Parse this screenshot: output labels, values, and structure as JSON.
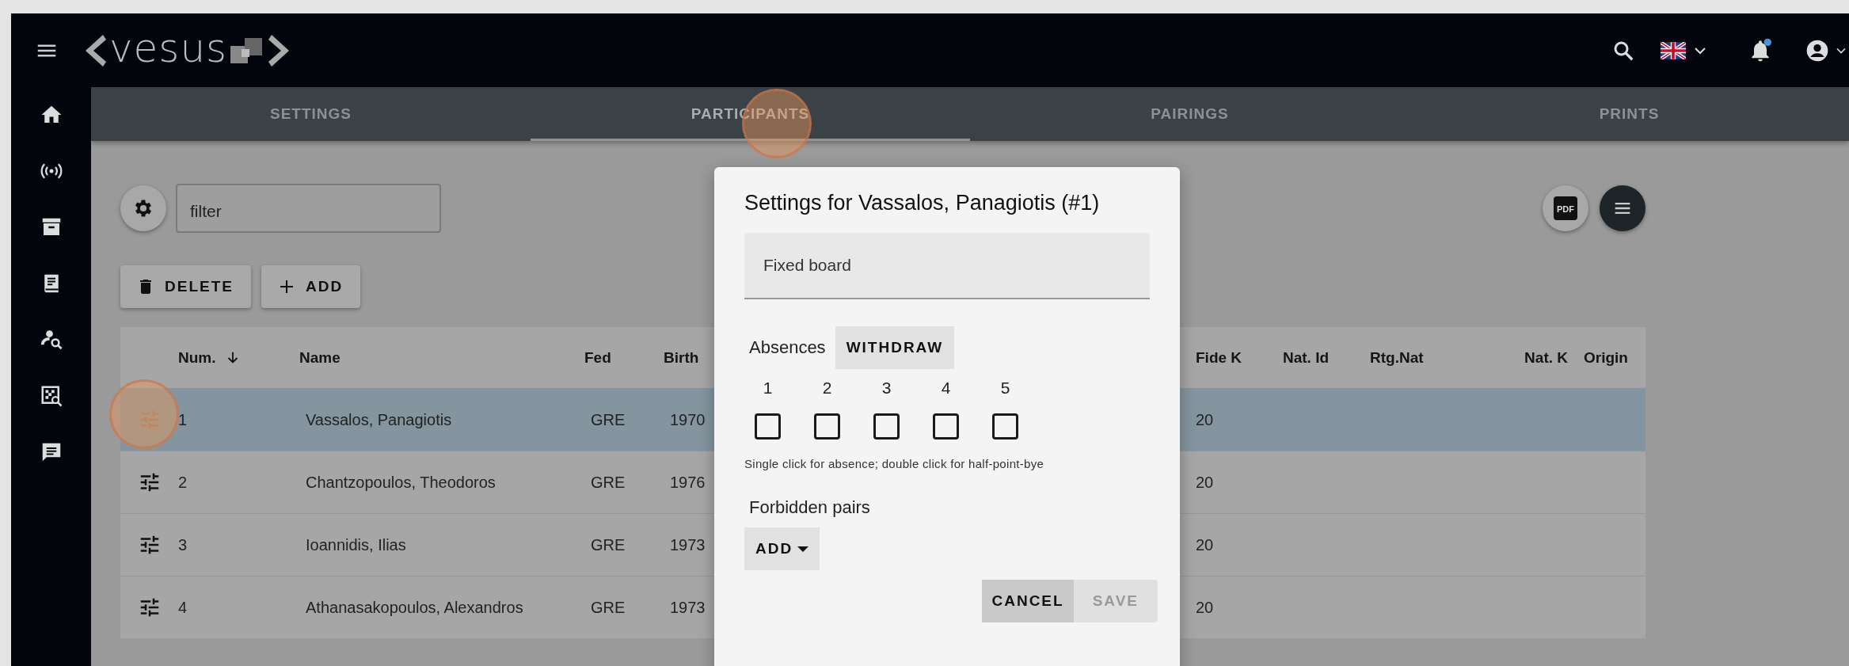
{
  "app": {
    "logo": "vesus",
    "notifications_unread": true
  },
  "tabs": [
    {
      "label": "SETTINGS",
      "selected": false
    },
    {
      "label": "PARTICIPANTS",
      "selected": true
    },
    {
      "label": "PAIRINGS",
      "selected": false
    },
    {
      "label": "PRINTS",
      "selected": false
    }
  ],
  "filter": {
    "placeholder": "filter"
  },
  "pdf_button": {
    "label": "PDF"
  },
  "toolbar_buttons": [
    {
      "kind": "delete",
      "label": "DELETE"
    },
    {
      "kind": "add",
      "label": "ADD"
    }
  ],
  "table": {
    "columns": [
      "Num.",
      "Name",
      "Fed",
      "Birth",
      "Fide K",
      "Nat. Id",
      "Rtg.Nat",
      "Nat. K",
      "Origin"
    ],
    "rows": [
      {
        "num": "1",
        "name": "Vassalos, Panagiotis",
        "fed": "GRE",
        "birth": "1970",
        "fide_k": "20",
        "selected": true
      },
      {
        "num": "2",
        "name": "Chantzopoulos, Theodoros",
        "fed": "GRE",
        "birth": "1976",
        "fide_k": "20",
        "selected": false
      },
      {
        "num": "3",
        "name": "Ioannidis, Ilias",
        "fed": "GRE",
        "birth": "1973",
        "fide_k": "20",
        "selected": false
      },
      {
        "num": "4",
        "name": "Athanasakopoulos, Alexandros",
        "fed": "GRE",
        "birth": "1973",
        "fide_k": "20",
        "selected": false
      }
    ]
  },
  "dialog": {
    "title": "Settings for Vassalos, Panagiotis (#1)",
    "fixed_board": {
      "placeholder": "Fixed board"
    },
    "absences_label": "Absences",
    "withdraw_button": "WITHDRAW",
    "rounds": [
      {
        "label": "1",
        "checked": false
      },
      {
        "label": "2",
        "checked": false
      },
      {
        "label": "3",
        "checked": false
      },
      {
        "label": "4",
        "checked": false
      },
      {
        "label": "5",
        "checked": false
      }
    ],
    "hint": "Single click for absence; double click for half-point-bye",
    "forbidden_pairs_label": "Forbidden pairs",
    "add_button": "ADD",
    "cancel_button": "CANCEL",
    "save_button": {
      "label": "SAVE",
      "disabled": true
    }
  }
}
